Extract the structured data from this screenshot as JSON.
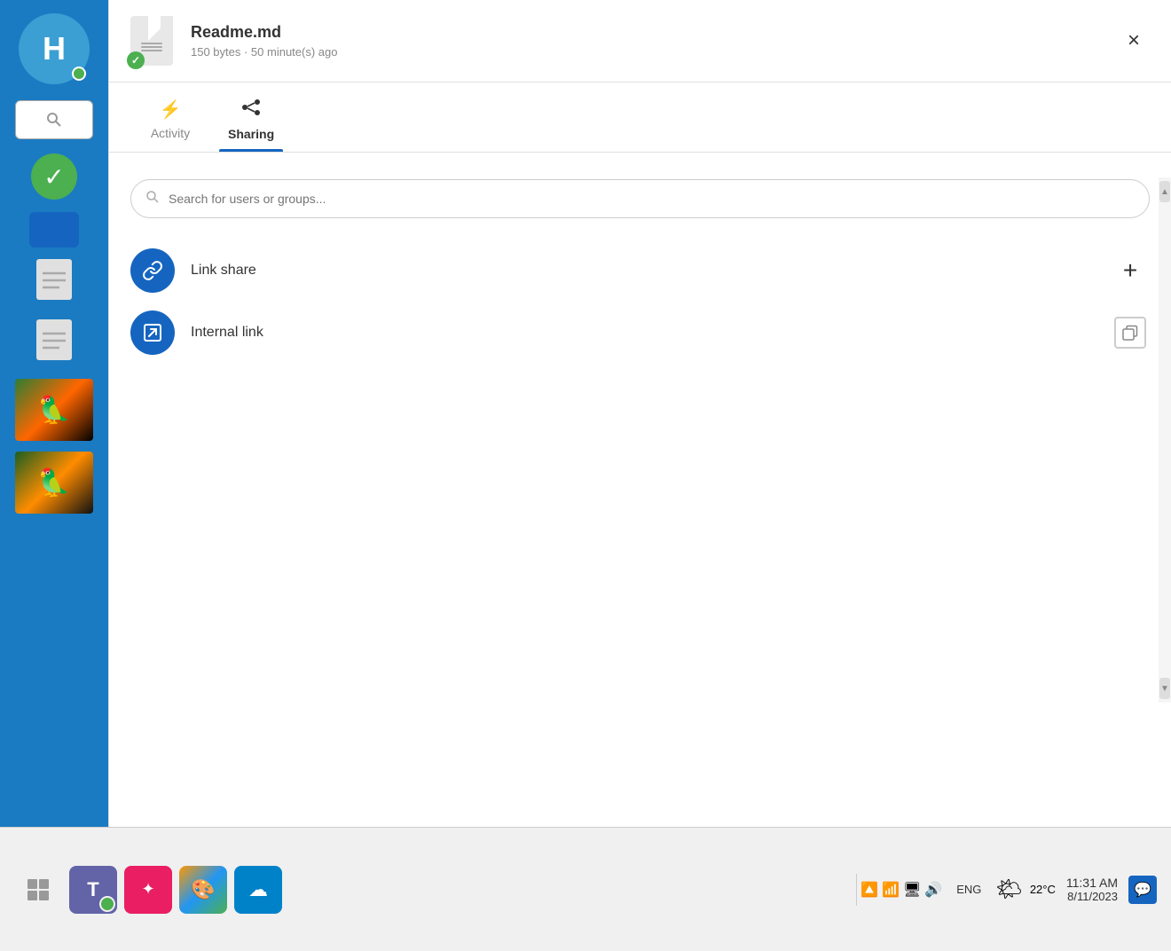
{
  "sidebar": {
    "avatar_letter": "H",
    "items": []
  },
  "panel": {
    "file_name": "Readme.md",
    "file_meta": "150 bytes · 50 minute(s) ago",
    "close_label": "×"
  },
  "tabs": [
    {
      "id": "activity",
      "label": "Activity",
      "icon": "⚡"
    },
    {
      "id": "sharing",
      "label": "Sharing",
      "icon": "🔗",
      "active": true
    }
  ],
  "sharing": {
    "search_placeholder": "Search for users or groups...",
    "items": [
      {
        "id": "link-share",
        "label": "Link share",
        "icon": "🔗",
        "action": "add"
      },
      {
        "id": "internal-link",
        "label": "Internal link",
        "icon": "↗",
        "action": "copy"
      }
    ]
  },
  "taskbar": {
    "apps": [
      {
        "id": "show-desktop",
        "label": "⊞",
        "type": "default"
      },
      {
        "id": "teams",
        "label": "T",
        "type": "teams"
      },
      {
        "id": "craft",
        "label": "✦",
        "type": "craft"
      },
      {
        "id": "paint",
        "label": "🎨",
        "type": "paint"
      },
      {
        "id": "nextcloud",
        "label": "☁",
        "type": "nextcloud"
      }
    ],
    "weather_icon": "🌤",
    "temperature": "22°C",
    "time": "11:31 AM",
    "date": "8/11/2023",
    "lang": "ENG"
  },
  "scrollbar": {
    "up_arrow": "▲",
    "down_arrow": "▼"
  }
}
